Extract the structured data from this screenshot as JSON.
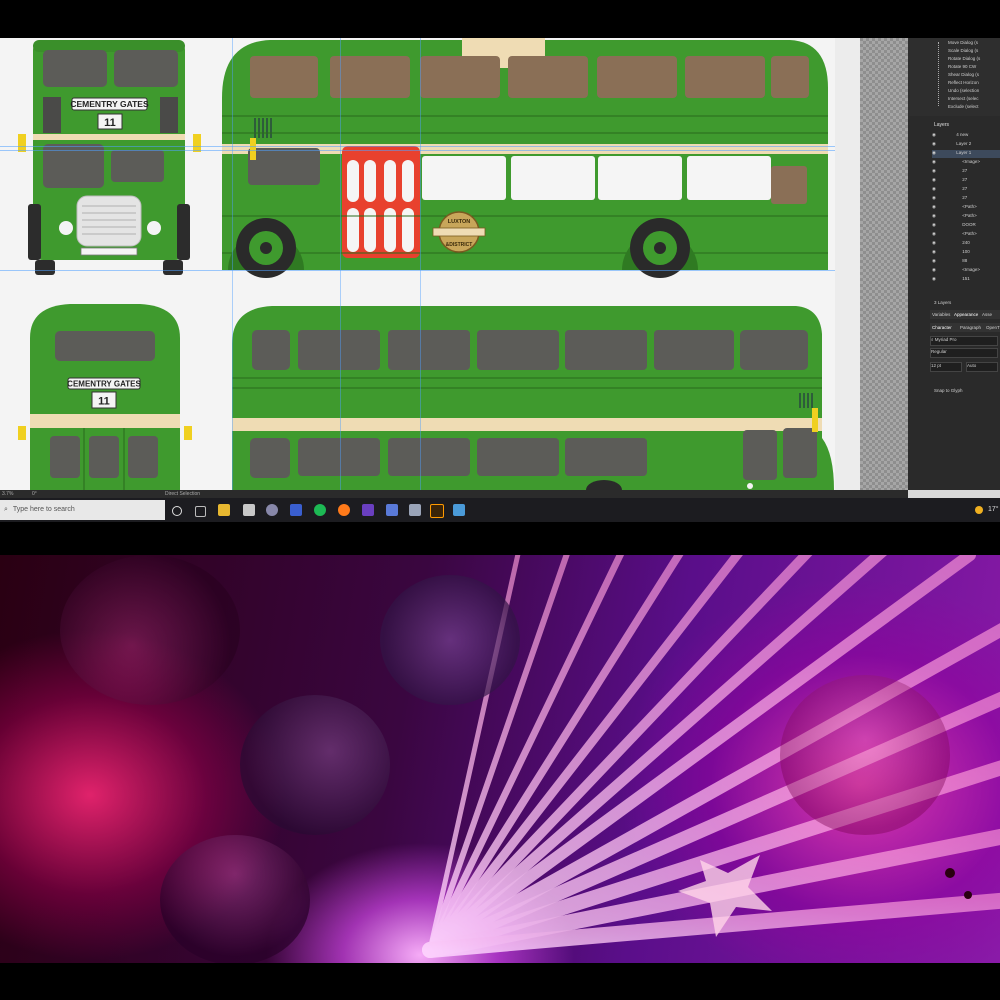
{
  "sign_front_upper": "CEMENTRY GATES",
  "sign_front_lower": "CEMENTRY GATES",
  "fleet_number_upper": "11",
  "fleet_number_lower": "11",
  "badge_top": "LUXTON",
  "badge_bottom": "&DISTRICT",
  "layers_panel": {
    "history_items": [
      "Move Dialog (s",
      "Scale Dialog (s",
      "Rotate Dialog (s",
      "Rotate 90 CW",
      "Shear Dialog (s",
      "Reflect Horizon",
      "Undo (selection",
      "Intersect (selec",
      "Exclude (select"
    ],
    "title": "Layers",
    "layers": [
      "4 new",
      "Layer 2",
      "Layer 1",
      "<Image>",
      "27",
      "27",
      "27",
      "27",
      "<Path>",
      "<Path>",
      "DOOR",
      "<Path>",
      "240",
      "100",
      "88",
      "<Image>",
      "151"
    ],
    "count": "3 Layers"
  },
  "properties": {
    "tabs": [
      "Variables",
      "Appearance",
      "Asse"
    ],
    "char_tabs": [
      "Character",
      "Paragraph",
      "OpenT"
    ],
    "font_name": "Myriad Pro",
    "font_style": "Regular",
    "font_size": "12 pt",
    "leading": "Auto",
    "snap": "Snap to Glyph"
  },
  "status": {
    "zoom": "3.7%",
    "angle": "0°",
    "tool": "Direct Selection"
  },
  "taskbar": {
    "search_placeholder": "Type here to search",
    "weather": "17°"
  },
  "colors": {
    "bus_green": "#3f9a2e",
    "bus_dark": "#2f7a22",
    "cream": "#efdcb4",
    "window": "#5c5c58",
    "door_red": "#e8412e"
  }
}
